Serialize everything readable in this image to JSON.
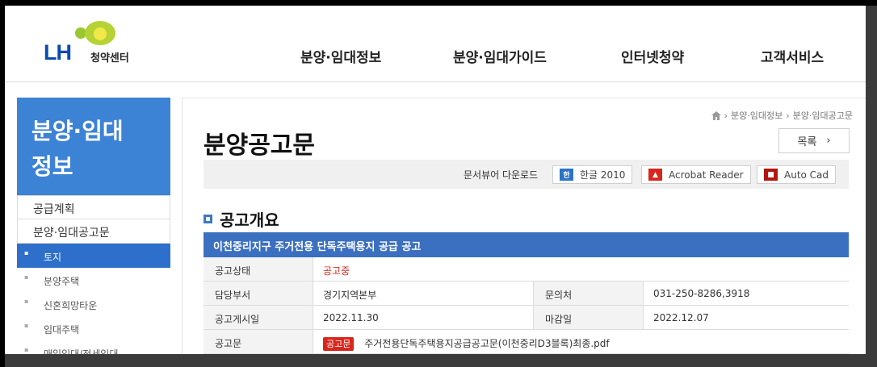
{
  "header": {
    "logo_main": "LH",
    "logo_sub": "청약센터",
    "nav": [
      "분양·임대정보",
      "분양·임대가이드",
      "인터넷청약",
      "고객서비스"
    ]
  },
  "sidebar": {
    "title_line1": "분양·임대",
    "title_line2": "정보",
    "items": [
      "공급계획",
      "분양·임대공고문"
    ],
    "sub_items": [
      "토지",
      "분양주택",
      "신혼희망타운",
      "임대주택",
      "매입임대/전세임대"
    ]
  },
  "breadcrumb": [
    "분양·임대정보",
    "분양·임대공고문"
  ],
  "page_title": "분양공고문",
  "list_button": "목록",
  "viewer": {
    "label": "문서뷰어 다운로드",
    "buttons": [
      "한글 2010",
      "Acrobat Reader",
      "Auto Cad"
    ]
  },
  "section_title": "공고개요",
  "table": {
    "title": "이천중리지구 주거전용 단독주택용지 공급 공고",
    "status_label": "공고상태",
    "status_value": "공고중",
    "dept_label": "담당부서",
    "dept_value": "경기지역본부",
    "contact_label": "문의처",
    "contact_value": "031-250-8286,3918",
    "post_label": "공고게시일",
    "post_value": "2022.11.30",
    "deadline_label": "마감일",
    "deadline_value": "2022.12.07",
    "doc_label": "공고문",
    "doc_tag": "공고문",
    "doc_file": "주거전용단독주택용지공급공고문(이천중리D3블록)최종.pdf"
  },
  "colors": {
    "brand_blue": "#3c82d5",
    "header_blue": "#3b6fc0",
    "status_red": "#d9261c"
  }
}
